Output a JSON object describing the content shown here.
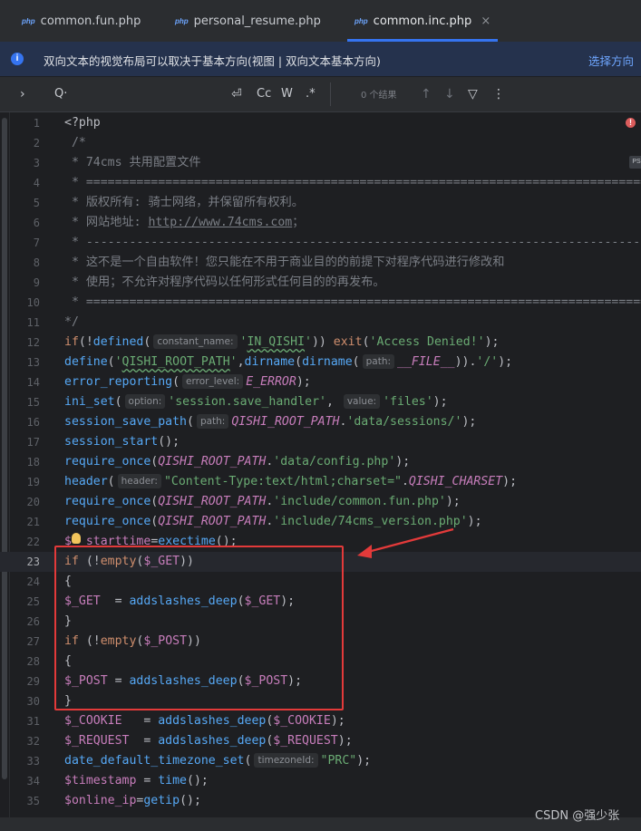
{
  "tabs": [
    {
      "icon": "php",
      "label": "common.fun.php",
      "active": false
    },
    {
      "icon": "php",
      "label": "personal_resume.php",
      "active": false
    },
    {
      "icon": "php",
      "label": "common.inc.php",
      "active": true,
      "close": "×"
    }
  ],
  "banner": {
    "message": "双向文本的视觉布局可以取决于基本方向(视图 | 双向文本基本方向)",
    "action": "选择方向"
  },
  "find": {
    "expand": "›",
    "search_icon": "Q·",
    "regex_newline": "⏎",
    "match_case": "Cc",
    "words": "W",
    "regex": ".*",
    "result_count": "0 个结果",
    "prev": "↑",
    "next": "↓",
    "filter": "▽",
    "more": "⋮"
  },
  "editor": {
    "current_line": 23,
    "lines": [
      {
        "n": "1",
        "html": "<span class='c-plain'>&lt;?php</span>"
      },
      {
        "n": "2",
        "html": "<span class='c-com'> /*</span>"
      },
      {
        "n": "3",
        "html": "<span class='c-com'> * 74cms 共用配置文件</span>"
      },
      {
        "n": "4",
        "html": "<span class='c-com'> * ================================================================================</span>"
      },
      {
        "n": "5",
        "html": "<span class='c-com'> * 版权所有: 骑士网络，并保留所有权利。</span>"
      },
      {
        "n": "6",
        "html": "<span class='c-com'> * 网站地址: </span><span class='c-link'>http://www.74cms.com</span><span class='c-com'>；</span>"
      },
      {
        "n": "7",
        "html": "<span class='c-com'> * ------------------------------------------------------------------------------</span>"
      },
      {
        "n": "8",
        "html": "<span class='c-com'> * 这不是一个自由软件！您只能在不用于商业目的的前提下对程序代码进行修改和</span>"
      },
      {
        "n": "9",
        "html": "<span class='c-com'> * 使用；不允许对程序代码以任何形式任何目的的再发布。</span>"
      },
      {
        "n": "10",
        "html": "<span class='c-com'> * ================================================================================</span>"
      },
      {
        "n": "11",
        "html": "<span class='c-com'>*/</span>"
      },
      {
        "n": "12",
        "html": "<span class='c-kw'>if</span>(!<span class='c-fn'>defined</span>(<span class='c-hint'>constant_name:</span><span class='c-str'>'<span class=\"wavy\">IN_QISHI</span>'</span>)) <span class='c-kw'>exit</span>(<span class='c-str'>'Access Denied!'</span>);"
      },
      {
        "n": "13",
        "html": "<span class='c-fn'>define</span>(<span class='c-str'>'<span class=\"wavy\">QISHI_ROOT_PATH</span>'</span>,<span class='c-fn'>dirname</span>(<span class='c-fn'>dirname</span>(<span class='c-hint'>path:</span><span class='c-const'>__FILE__</span>)).<span class='c-str'>'/'</span>);"
      },
      {
        "n": "14",
        "html": "<span class='c-fn'>error_reporting</span>(<span class='c-hint'>error_level:</span><span class='c-const'>E_ERROR</span>);"
      },
      {
        "n": "15",
        "html": "<span class='c-fn'>ini_set</span>(<span class='c-hint'>option:</span><span class='c-str'>'session.save_handler'</span>, <span class='c-hint'>value:</span><span class='c-str'>'files'</span>);"
      },
      {
        "n": "16",
        "html": "<span class='c-fn'>session_save_path</span>(<span class='c-hint'>path:</span><span class='c-const'>QISHI_ROOT_PATH</span>.<span class='c-str'>'data/sessions/'</span>);"
      },
      {
        "n": "17",
        "html": "<span class='c-fn'>session_start</span>();"
      },
      {
        "n": "18",
        "html": "<span class='c-fn'>require_once</span>(<span class='c-const'>QISHI_ROOT_PATH</span>.<span class='c-str'>'data/config.php'</span>);"
      },
      {
        "n": "19",
        "html": "<span class='c-fn'>header</span>(<span class='c-hint'>header:</span><span class='c-str'>\"Content-Type:text/html;charset=\"</span>.<span class='c-const'>QISHI_CHARSET</span>);"
      },
      {
        "n": "20",
        "html": "<span class='c-fn'>require_once</span>(<span class='c-const'>QISHI_ROOT_PATH</span>.<span class='c-str'>'include/common.fun.php'</span>);"
      },
      {
        "n": "21",
        "html": "<span class='c-fn'>require_once</span>(<span class='c-const'>QISHI_ROOT_PATH</span>.<span class='c-str'>'include/74cms_version.php'</span>);"
      },
      {
        "n": "22",
        "html": "<span class='c-var'>$</span>  <span class='c-var'>starttime</span>=<span class='c-fn'>exectime</span>();"
      },
      {
        "n": "23",
        "html": "<span class='c-kw'>if</span> (!<span class='c-kw'>empty</span>(<span class='c-var'>$_GET</span>))"
      },
      {
        "n": "24",
        "html": "{"
      },
      {
        "n": "25",
        "html": "<span class='c-var'>$_GET</span>  = <span class='c-fn'>addslashes_deep</span>(<span class='c-var'>$_GET</span>);"
      },
      {
        "n": "26",
        "html": "}"
      },
      {
        "n": "27",
        "html": "<span class='c-kw'>if</span> (!<span class='c-kw'>empty</span>(<span class='c-var'>$_POST</span>))"
      },
      {
        "n": "28",
        "html": "{"
      },
      {
        "n": "29",
        "html": "<span class='c-var'>$_POST</span> = <span class='c-fn'>addslashes_deep</span>(<span class='c-var'>$_POST</span>);"
      },
      {
        "n": "30",
        "html": "}"
      },
      {
        "n": "31",
        "html": "<span class='c-var'>$_COOKIE</span>   = <span class='c-fn'>addslashes_deep</span>(<span class='c-var'>$_COOKIE</span>);"
      },
      {
        "n": "32",
        "html": "<span class='c-var'>$_REQUEST</span>  = <span class='c-fn'>addslashes_deep</span>(<span class='c-var'>$_REQUEST</span>);"
      },
      {
        "n": "33",
        "html": "<span class='c-fn'>date_default_timezone_set</span>(<span class='c-hint'>timezoneId:</span><span class='c-str'>\"PRC\"</span>);"
      },
      {
        "n": "34",
        "html": "<span class='c-var'>$timestamp</span> = <span class='c-fn'>time</span>();"
      },
      {
        "n": "35",
        "html": "<span class='c-var'>$online_ip</span>=<span class='c-fn'>getip</span>();"
      }
    ]
  },
  "gutter": {
    "error_icon": "!",
    "file_badge": "PS"
  },
  "watermark": "CSDN @强少张",
  "colors": {
    "accent": "#3574f0",
    "highlight": "#e33a3a",
    "background": "#1e1f22"
  }
}
